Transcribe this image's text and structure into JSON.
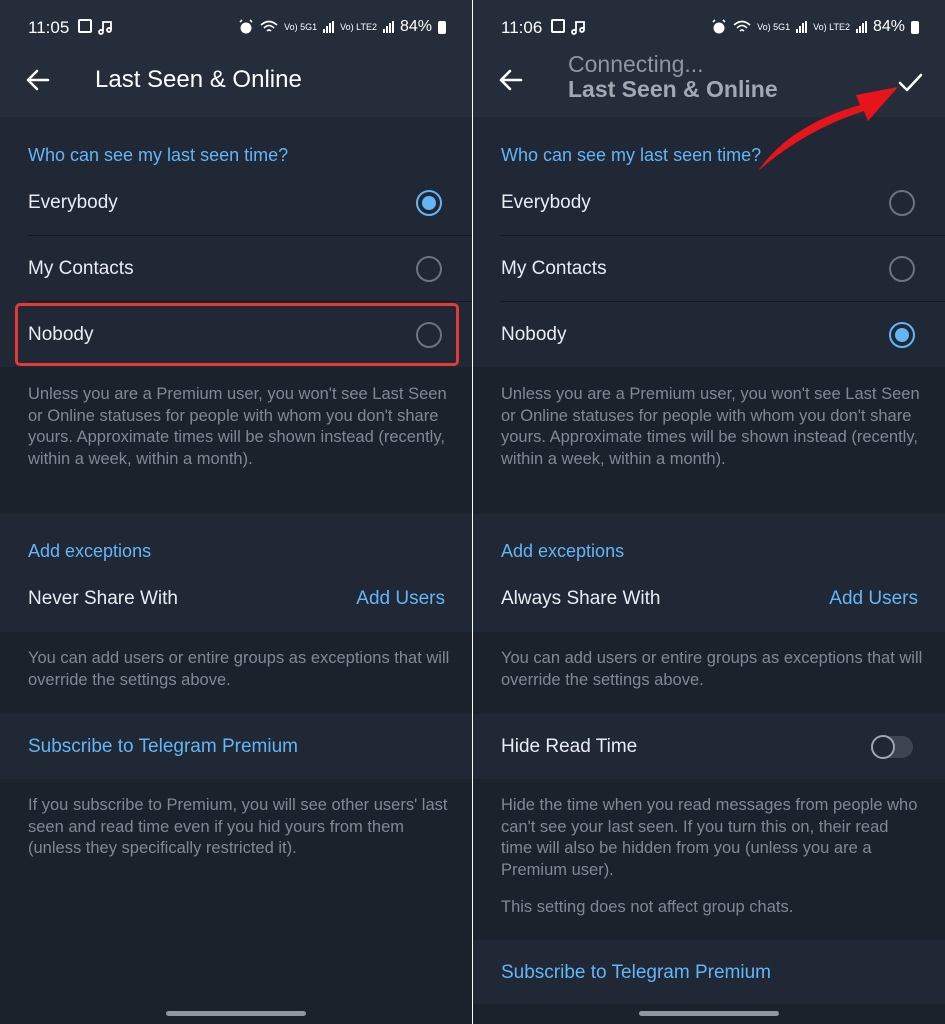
{
  "left": {
    "status": {
      "time": "11:05",
      "battery": "84%",
      "net1": "Vo) 5G1",
      "net2": "Vo) LTE2"
    },
    "title": "Last Seen & Online",
    "section1": {
      "header": "Who can see my last seen time?",
      "options": [
        "Everybody",
        "My Contacts",
        "Nobody"
      ],
      "selected": "Everybody",
      "note": "Unless you are a Premium user, you won't see Last Seen or Online statuses for people with whom you don't share yours. Approximate times will be shown instead (recently, within a week, within a month)."
    },
    "exceptions": {
      "header": "Add exceptions",
      "row_label": "Never Share With",
      "action": "Add Users",
      "note": "You can add users or entire groups as exceptions that will override the settings above."
    },
    "premium": {
      "link": "Subscribe to Telegram Premium",
      "note": "If you subscribe to Premium, you will see other users' last seen and read time even if you hid yours from them (unless they specifically restricted it)."
    }
  },
  "right": {
    "status": {
      "time": "11:06",
      "battery": "84%",
      "net1": "Vo) 5G1",
      "net2": "Vo) LTE2"
    },
    "subtitle": "Connecting...",
    "title": "Last Seen & Online",
    "section1": {
      "header": "Who can see my last seen time?",
      "options": [
        "Everybody",
        "My Contacts",
        "Nobody"
      ],
      "selected": "Nobody",
      "note": "Unless you are a Premium user, you won't see Last Seen or Online statuses for people with whom you don't share yours. Approximate times will be shown instead (recently, within a week, within a month)."
    },
    "exceptions": {
      "header": "Add exceptions",
      "row_label": "Always Share With",
      "action": "Add Users",
      "note": "You can add users or entire groups as exceptions that will override the settings above."
    },
    "hide_read": {
      "label": "Hide Read Time",
      "enabled": false,
      "note": "Hide the time when you read messages from people who can't see your last seen. If you turn this on, their read time will also be hidden from you (unless you are a Premium user).",
      "note2": "This setting does not affect group chats."
    },
    "premium": {
      "link": "Subscribe to Telegram Premium"
    }
  },
  "colors": {
    "accent": "#64b5f6",
    "annotation_red": "#e53935",
    "background": "#1b222c",
    "section": "#1f2834"
  }
}
